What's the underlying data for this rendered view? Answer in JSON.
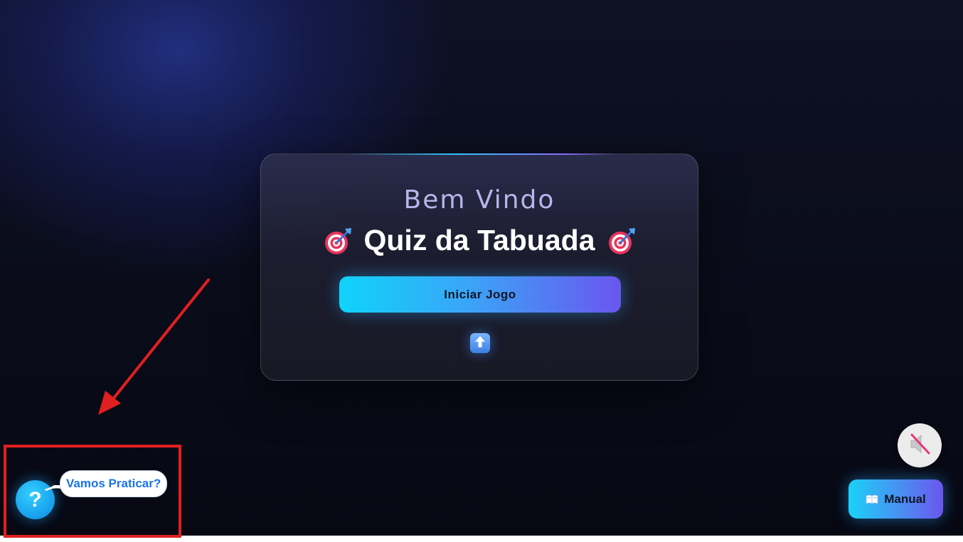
{
  "welcome_card": {
    "greeting": "Bem Vindo",
    "title": "Quiz da Tabuada",
    "start_button_label": "Iniciar Jogo",
    "left_icon": "dart-target-icon",
    "right_icon": "dart-target-icon",
    "up_icon": "up-arrow-icon"
  },
  "help": {
    "icon_label": "?",
    "bubble_text": "Vamos Praticar?"
  },
  "sound": {
    "icon": "speaker-muted-icon"
  },
  "manual": {
    "label": "Manual",
    "icon": "open-book-icon"
  },
  "annotation": {
    "arrow_color": "#e02020",
    "box_color": "#e02020"
  },
  "colors": {
    "accent_cyan": "#0fd3fa",
    "accent_violet": "#6a56ee",
    "greeting_color": "#b4b7ea",
    "bubble_text_color": "#1a73e8"
  }
}
